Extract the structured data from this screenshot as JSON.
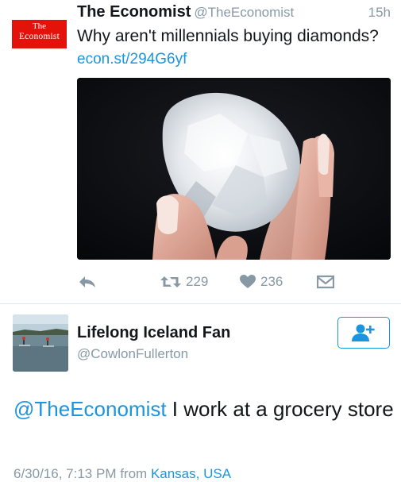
{
  "tweet1": {
    "logo_line1": "The",
    "logo_line2": "Economist",
    "name": "The Economist",
    "handle": "@TheEconomist",
    "time": "15h",
    "text": "Why aren't millennials buying diamonds?",
    "link": "econ.st/294G6yf",
    "retweets": "229",
    "likes": "236"
  },
  "tweet2": {
    "name": "Lifelong Iceland Fan",
    "handle": "@CowlonFullerton",
    "mention": "@TheEconomist",
    "text": " I work at a grocery store",
    "timestamp": "6/30/16, 7:13 PM",
    "from_word": " from ",
    "location": "Kansas, USA"
  },
  "icons": {
    "reply": "reply-icon",
    "retweet": "retweet-icon",
    "like": "heart-icon",
    "dm": "envelope-icon",
    "follow": "add-user-icon"
  },
  "colors": {
    "brand_red": "#e3120b",
    "link_blue": "#1b95e0",
    "muted_gray": "#8899a6",
    "text_dark": "#14171a"
  }
}
